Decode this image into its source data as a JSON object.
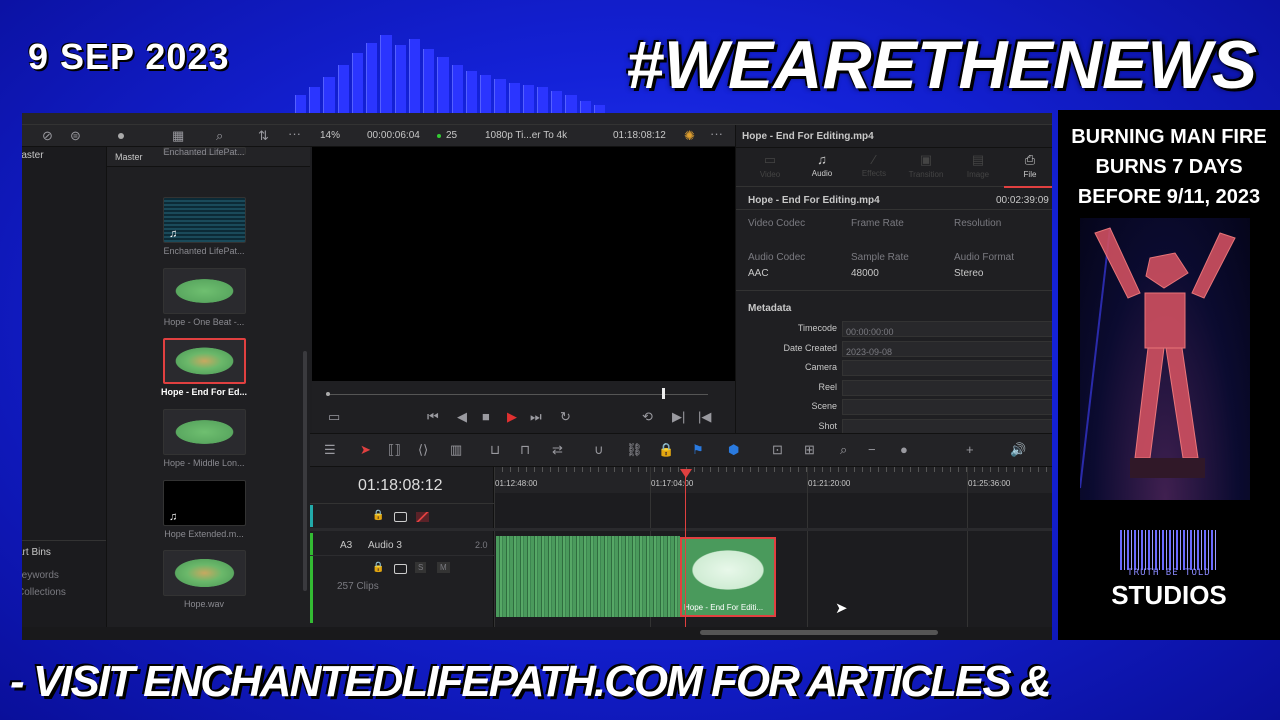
{
  "overlay": {
    "date": "9 SEP 2023",
    "headline": "#WEARETHENEWS",
    "banner": "- VISIT ENCHANTEDLIFEPATH.COM FOR ARTICLES &",
    "side_title": [
      "BURNING MAN FIRE",
      "BURNS 7 DAYS",
      "BEFORE 9/11, 2023"
    ],
    "logo_sub": "TRUTH BE TOLD",
    "logo_main": "STUDIOS",
    "colors": {
      "background": "#1422d8",
      "text": "#ffffff"
    }
  },
  "toolbar": {
    "zoom": "14%",
    "source_timecode": "00:00:06:04",
    "fps": "25",
    "timeline_name": "1080p Ti...er To 4k",
    "record_timecode": "01:18:08:12"
  },
  "bins": {
    "master": "Master",
    "smart_bins": "Smart Bins",
    "keywords": "Keywords",
    "collections": "Collections"
  },
  "media_pool": {
    "header": "Master",
    "items": [
      {
        "label": "Enchanted LifePat...",
        "type": "partial"
      },
      {
        "label": "Enchanted LifePat...",
        "type": "video"
      },
      {
        "label": "Hope  - One Beat -...",
        "type": "audio"
      },
      {
        "label": "Hope - End For Ed...",
        "type": "audio",
        "selected": true
      },
      {
        "label": "Hope - Middle Lon...",
        "type": "audio"
      },
      {
        "label": "Hope Extended.m...",
        "type": "music"
      },
      {
        "label": "Hope.wav",
        "type": "audio"
      }
    ]
  },
  "inspector": {
    "title": "Hope - End For Editing.mp4",
    "tabs": [
      {
        "label": "Video",
        "icon": "film-icon",
        "enabled": false
      },
      {
        "label": "Audio",
        "icon": "music-note-icon",
        "enabled": true
      },
      {
        "label": "Effects",
        "icon": "wand-icon",
        "enabled": false
      },
      {
        "label": "Transition",
        "icon": "transition-icon",
        "enabled": false
      },
      {
        "label": "Image",
        "icon": "image-icon",
        "enabled": false
      },
      {
        "label": "File",
        "icon": "file-icon",
        "enabled": true,
        "active": true
      }
    ],
    "clip_name": "Hope - End For Editing.mp4",
    "duration": "00:02:39:09",
    "props": [
      {
        "label": "Video Codec",
        "value": ""
      },
      {
        "label": "Frame Rate",
        "value": ""
      },
      {
        "label": "Resolution",
        "value": ""
      },
      {
        "label": "Audio Codec",
        "value": "AAC"
      },
      {
        "label": "Sample Rate",
        "value": "48000"
      },
      {
        "label": "Audio Format",
        "value": "Stereo"
      }
    ],
    "metadata_title": "Metadata",
    "metadata": [
      {
        "label": "Timecode",
        "value": "00:00:00:00"
      },
      {
        "label": "Date Created",
        "value": "2023-09-08"
      },
      {
        "label": "Camera",
        "value": ""
      },
      {
        "label": "Reel",
        "value": ""
      },
      {
        "label": "Scene",
        "value": ""
      },
      {
        "label": "Shot",
        "value": ""
      }
    ]
  },
  "viewer": {
    "scrub_position": 0.88
  },
  "timeline": {
    "timecode": "01:18:08:12",
    "ruler": [
      "01:12:48:00",
      "01:17:04:00",
      "01:21:20:00",
      "01:25:36:00"
    ],
    "track": {
      "id": "A3",
      "name": "Audio 3",
      "channels": "2.0",
      "solo": "S",
      "mute": "M",
      "clip_count": "257 Clips"
    },
    "selected_clip": "Hope - End For Editi...",
    "accent": "#e04040",
    "clip_color": "#4a9a5c"
  }
}
